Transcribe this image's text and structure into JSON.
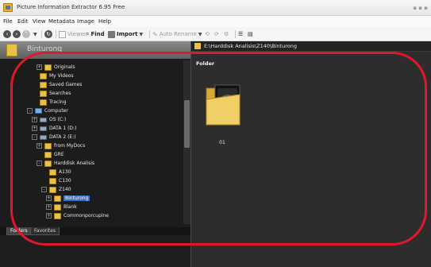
{
  "window": {
    "title": "Picture Information Extractor 6.95 Free"
  },
  "menu": [
    "File",
    "Edit",
    "View",
    "Metadata",
    "Image",
    "Help"
  ],
  "toolbar": {
    "viewer_label": "Viewer",
    "find_label": "Find",
    "import_label": "Import",
    "auto_rename_label": "Auto Rename"
  },
  "left_header": {
    "label": "Binturong"
  },
  "path_bar": {
    "path": "E:\\Harddisk Analisis\\Z140\\Binturong"
  },
  "tree": {
    "items": [
      {
        "label": "Originals",
        "icon": "folder-icon",
        "level": 2,
        "expander": "+"
      },
      {
        "label": "My Videos",
        "icon": "folder-icon",
        "level": 1,
        "expander": ""
      },
      {
        "label": "Saved Games",
        "icon": "folder-icon",
        "level": 1,
        "expander": ""
      },
      {
        "label": "Searches",
        "icon": "folder-icon",
        "level": 1,
        "expander": ""
      },
      {
        "label": "Tracing",
        "icon": "folder-icon",
        "level": 1,
        "expander": ""
      },
      {
        "label": "Computer",
        "icon": "computer-icon",
        "level": 0,
        "expander": "-"
      },
      {
        "label": "OS (C:)",
        "icon": "drive-icon",
        "level": 1,
        "expander": "+"
      },
      {
        "label": "DATA 1 (D:)",
        "icon": "drive-icon",
        "level": 1,
        "expander": "+"
      },
      {
        "label": "DATA 2 (E:)",
        "icon": "drive-icon",
        "level": 1,
        "expander": "-"
      },
      {
        "label": "from MyDocs",
        "icon": "folder-icon",
        "level": 2,
        "expander": "+"
      },
      {
        "label": "GRE",
        "icon": "folder-icon",
        "level": 2,
        "expander": ""
      },
      {
        "label": "Harddisk Analisis",
        "icon": "folder-icon",
        "level": 2,
        "expander": "-"
      },
      {
        "label": "A130",
        "icon": "folder-icon",
        "level": 3,
        "expander": ""
      },
      {
        "label": "C130",
        "icon": "folder-icon",
        "level": 3,
        "expander": ""
      },
      {
        "label": "Z140",
        "icon": "folder-icon",
        "level": 3,
        "expander": "-"
      },
      {
        "label": "Binturong",
        "icon": "folder-icon",
        "level": 4,
        "expander": "+",
        "selected": true
      },
      {
        "label": "Blank",
        "icon": "folder-icon",
        "level": 4,
        "expander": "+"
      },
      {
        "label": "Commonporcupine",
        "icon": "folder-icon",
        "level": 4,
        "expander": "+"
      }
    ]
  },
  "tabs": [
    {
      "label": "Folders",
      "active": true
    },
    {
      "label": "Favorites",
      "active": false
    }
  ],
  "main": {
    "section_label": "Folder",
    "items": [
      {
        "name": "01"
      }
    ]
  },
  "colors": {
    "highlight": "#e0182b",
    "selection": "#3a6fc4",
    "folder": "#e8c14a"
  }
}
